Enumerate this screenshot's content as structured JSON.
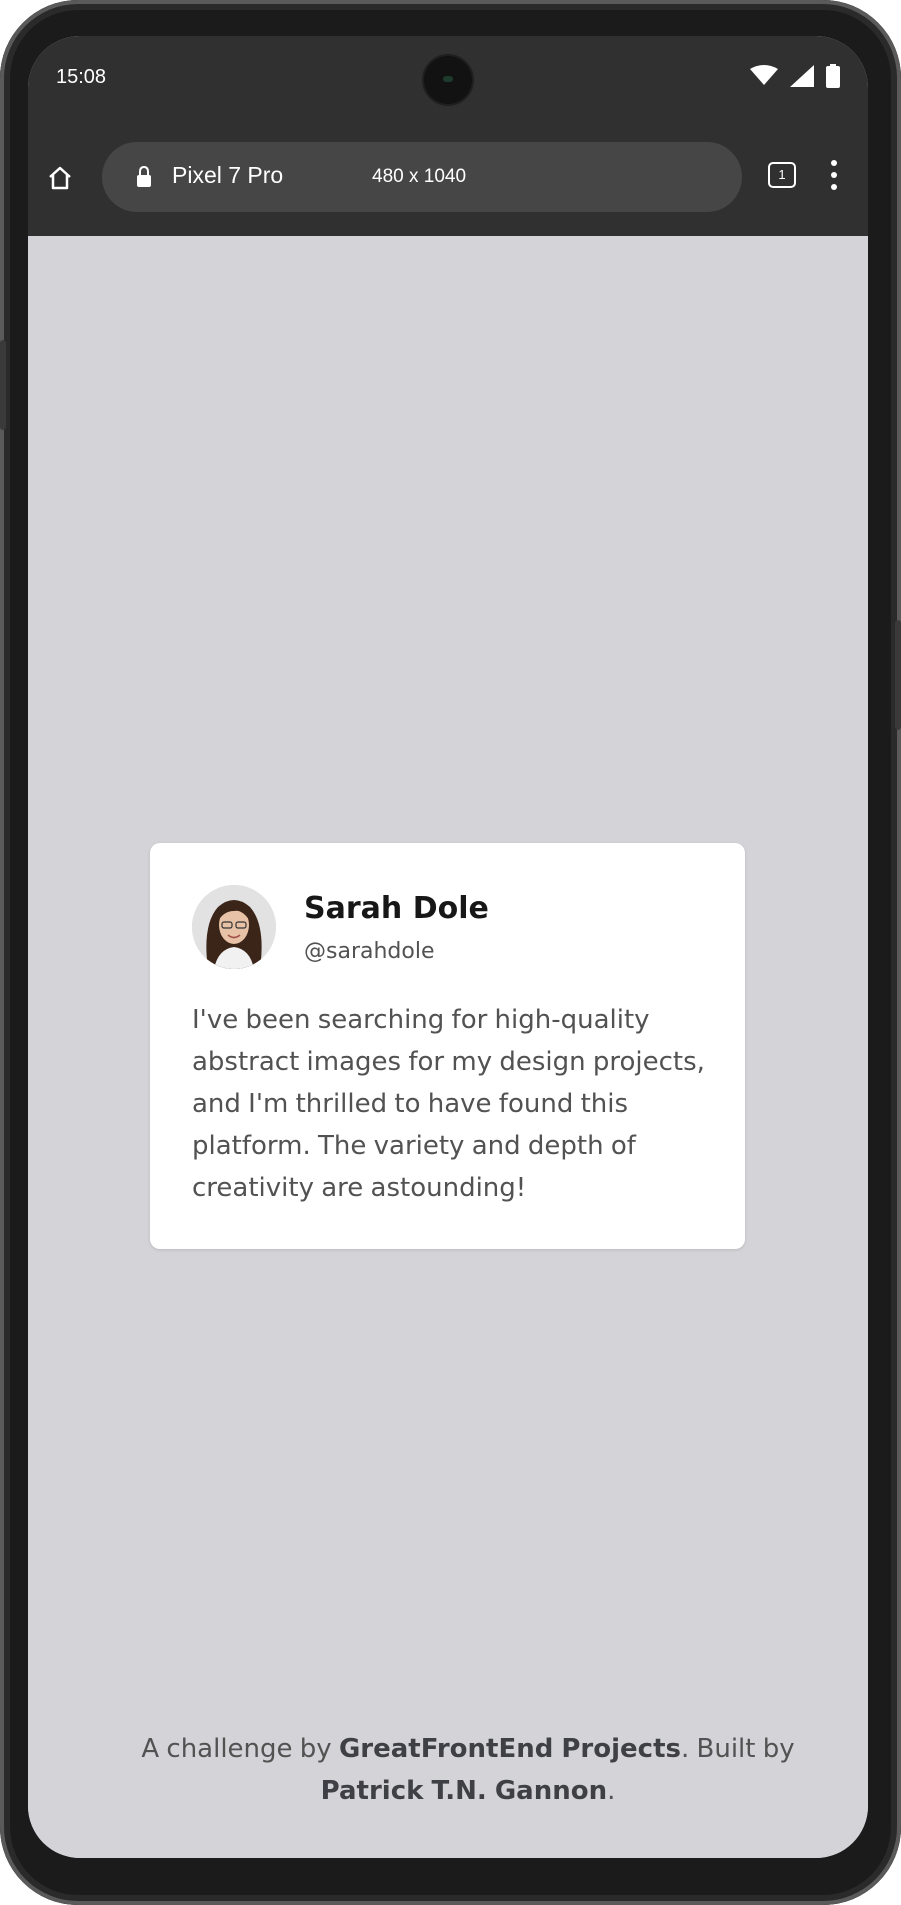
{
  "status_bar": {
    "time": "15:08"
  },
  "browser": {
    "device_name": "Pixel 7 Pro",
    "dimensions": "480 x 1040",
    "tab_count": "1"
  },
  "testimonial": {
    "name": "Sarah Dole",
    "handle": "@sarahdole",
    "quote": "I've been searching for high-quality abstract images for my design projects, and I'm thrilled to have found this platform. The variety and depth of creativity are astounding!"
  },
  "footer": {
    "prefix": "A challenge by ",
    "challenge_link": "GreatFrontEnd Projects",
    "middle": ". Built by ",
    "author_link": "Patrick T.N. Gannon",
    "suffix": "."
  },
  "colors": {
    "page_background": "#d4d4d8",
    "browser_chrome": "#303030",
    "card_background": "#ffffff"
  },
  "icons": [
    "home-icon",
    "lock-icon",
    "wifi-icon",
    "signal-icon",
    "battery-icon",
    "tabs-icon",
    "more-vert-icon"
  ]
}
